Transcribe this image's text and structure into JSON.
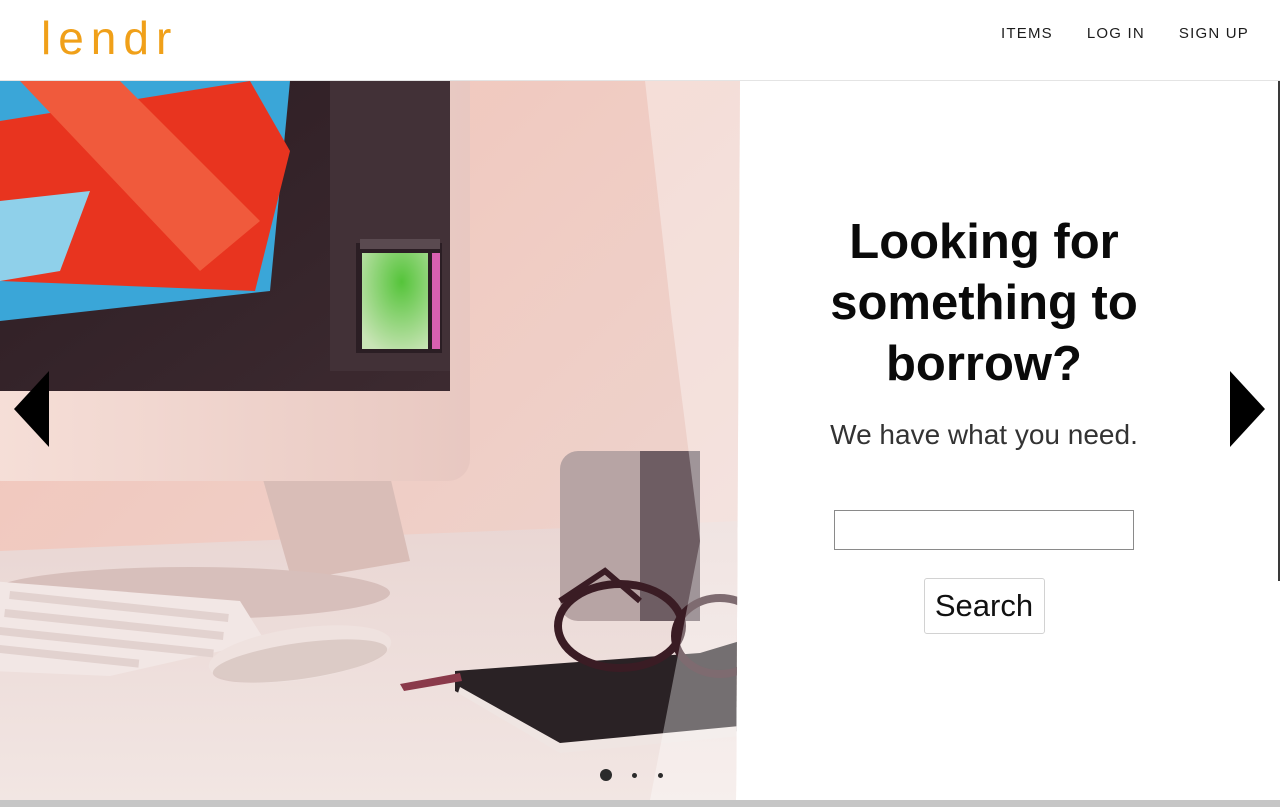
{
  "brand": {
    "logo": "lendr",
    "color": "#f0a019"
  },
  "nav": {
    "items": [
      "ITEMS",
      "LOG IN",
      "SIGN UP"
    ]
  },
  "hero": {
    "headline": "Looking for something to borrow?",
    "subhead": "We have what you need.",
    "search": {
      "placeholder": "",
      "value": "",
      "button_label": "Search"
    },
    "carousel": {
      "slides": 3,
      "active": 1
    }
  },
  "icons": {
    "prev": "chevron-left-icon",
    "next": "chevron-right-icon"
  }
}
